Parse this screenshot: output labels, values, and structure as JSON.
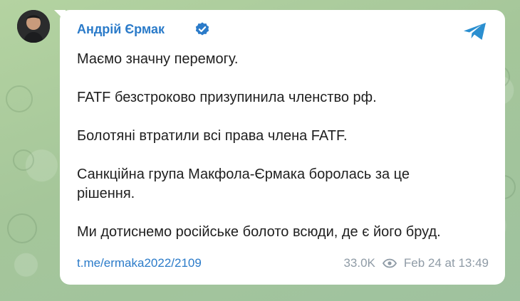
{
  "post": {
    "author": "Андрій Єрмак",
    "flag_icon": "ukraine-flag-icon",
    "verified_icon": "verified-badge-icon",
    "share_icon": "telegram-share-icon",
    "paragraphs": [
      "Маємо значну перемогу.",
      "FATF безстроково призупинила членство рф.",
      "Болотяні втратили всі права члена FATF.",
      "Санкційна група Макфола-Єрмака боролась за це",
      "рішення.",
      "Ми дотиснемо російське болото всюди, де є його бруд."
    ],
    "link": "t.me/ermaka2022/2109",
    "views": "33.0K",
    "views_icon": "eye-icon",
    "timestamp": "Feb 24 at 13:49"
  },
  "colors": {
    "accent": "#2b7bc9",
    "bubble": "#ffffff",
    "meta": "#8f9ba6",
    "background": "#a9c79a"
  }
}
